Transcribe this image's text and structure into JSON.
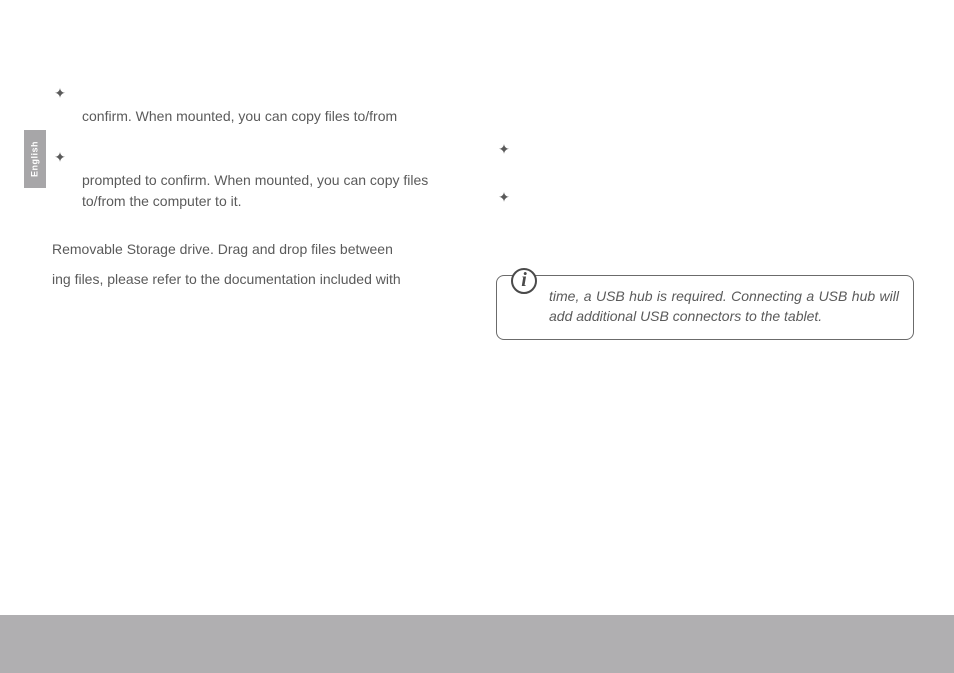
{
  "language_tab": "English",
  "left_column": {
    "bullet1": "confirm. When mounted, you can copy files to/from",
    "bullet2": "prompted to confirm. When mounted, you can copy files to/from the computer to it.",
    "para1": "Removable Storage drive. Drag and drop files between",
    "para2": "ing files, please refer to the documentation included with"
  },
  "info_box": {
    "icon_label": "i",
    "text": "time, a USB  hub is required. Connecting a USB hub will add additional USB connectors to the tablet."
  },
  "bullet_glyph": "✦"
}
